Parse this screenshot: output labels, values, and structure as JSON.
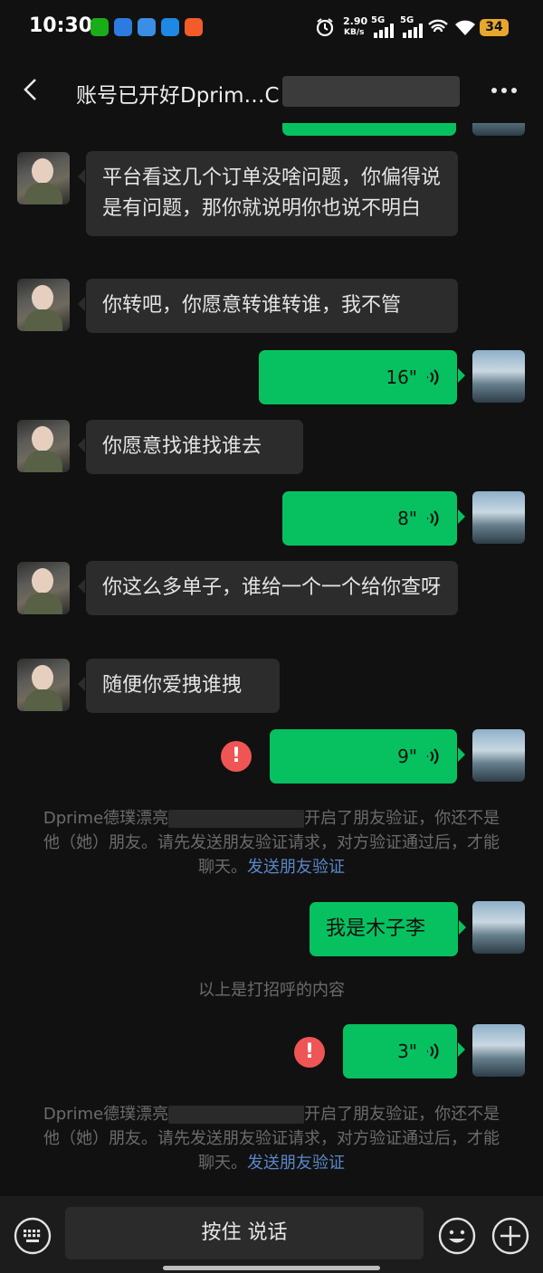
{
  "status": {
    "time": "10:30",
    "net_speed_value": "2.90",
    "net_speed_unit": "KB/s",
    "sig1_label": "5G",
    "sig2_label": "5G",
    "battery": "34"
  },
  "header": {
    "title": "账号已开好Dprim…C",
    "back_icon": "back-chevron-icon",
    "more_icon": "more-dots-icon"
  },
  "colors": {
    "sent_bubble": "#07c160",
    "received_bubble": "#2c2c2c",
    "error": "#f05555",
    "link": "#5b86c8",
    "background": "#111111"
  },
  "messages": [
    {
      "side": "left",
      "type": "text",
      "text": "平台看这几个订单没啥问题，你偏得说是有问题，那你就说明你也说不明白"
    },
    {
      "side": "left",
      "type": "text",
      "text": "你转吧，你愿意转谁转谁，我不管"
    },
    {
      "side": "right",
      "type": "voice",
      "duration": "16\""
    },
    {
      "side": "left",
      "type": "text",
      "text": "你愿意找谁找谁去"
    },
    {
      "side": "right",
      "type": "voice",
      "duration": "8\""
    },
    {
      "side": "left",
      "type": "text",
      "text": "你这么多单子，谁给一个一个给你查呀"
    },
    {
      "side": "left",
      "type": "text",
      "text": "随便你爱拽谁拽"
    },
    {
      "side": "right",
      "type": "voice",
      "duration": "9\"",
      "failed": true
    },
    {
      "side": "right",
      "type": "text",
      "text": "我是木子李"
    },
    {
      "side": "right",
      "type": "voice",
      "duration": "3\"",
      "failed": true
    }
  ],
  "system_notices": [
    {
      "prefix": "Dprime德璞漂亮",
      "suffix": "开启了朋友验证，你还不是他（她）朋友。请先发送朋友验证请求，对方验证通过后，才能聊天。",
      "link": "发送朋友验证"
    },
    {
      "prefix": "Dprime德璞漂亮",
      "suffix": "开启了朋友验证，你还不是他（她）朋友。请先发送朋友验证请求，对方验证通过后，才能聊天。",
      "link": "发送朋友验证"
    }
  ],
  "greeting_notice": "以上是打招呼的内容",
  "failed_mark": "!",
  "bottom": {
    "hold_to_talk": "按住 说话",
    "keyboard_icon": "keyboard-icon",
    "emoji_icon": "emoji-icon",
    "plus_icon": "plus-icon"
  }
}
